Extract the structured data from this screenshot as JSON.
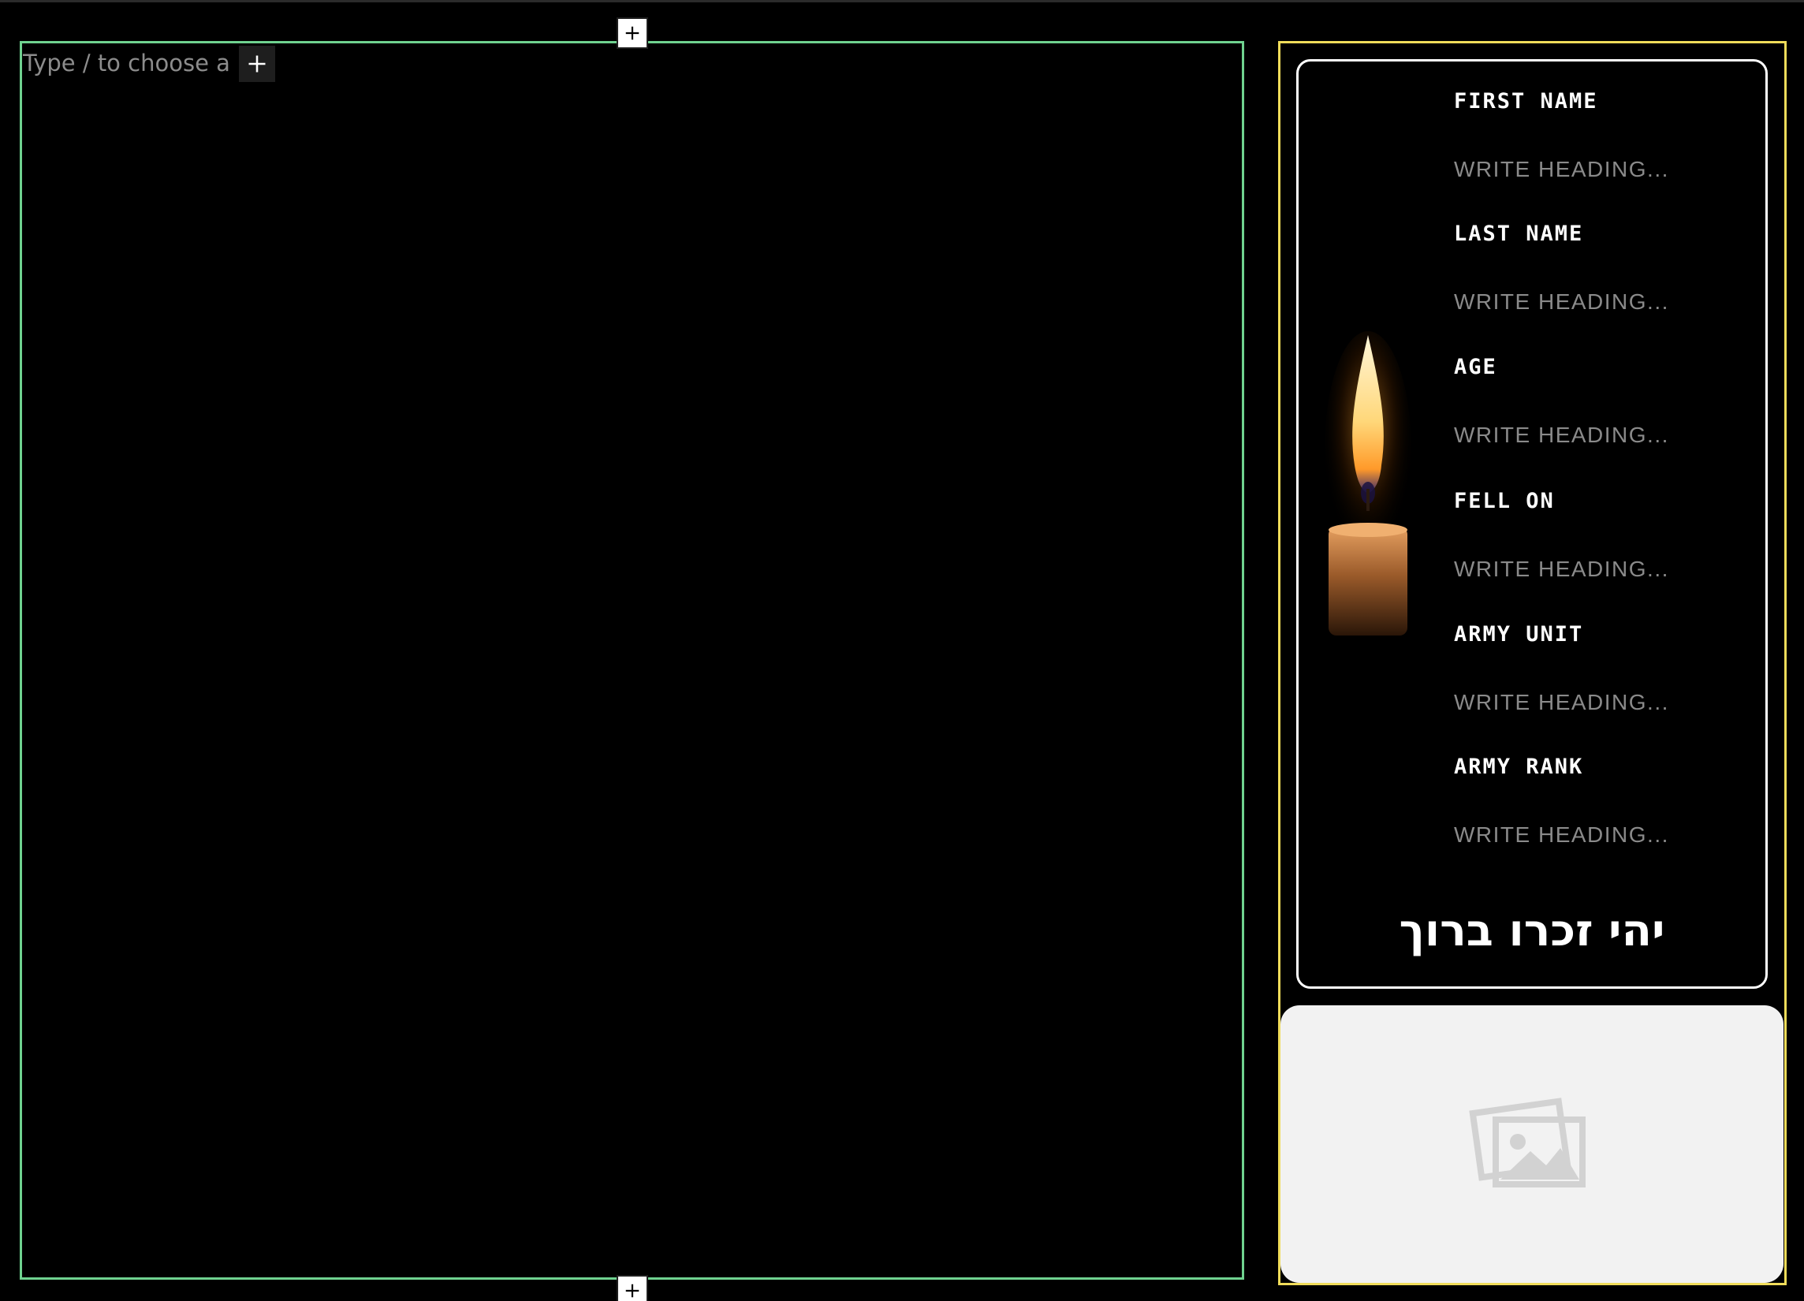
{
  "editor": {
    "placeholder": "Type / to choose a bl",
    "inserter_top_label": "Add block",
    "inserter_bottom_label": "Add block",
    "block_inserter_label": "Add block"
  },
  "memorial": {
    "fields": [
      {
        "label": "FIRST NAME",
        "value": "WRITE HEADING..."
      },
      {
        "label": "LAST NAME",
        "value": "WRITE HEADING..."
      },
      {
        "label": "AGE",
        "value": "WRITE HEADING..."
      },
      {
        "label": "FELL ON",
        "value": "WRITE HEADING..."
      },
      {
        "label": "ARMY UNIT",
        "value": "WRITE HEADING..."
      },
      {
        "label": "ARMY RANK",
        "value": "WRITE HEADING..."
      }
    ],
    "blessing": "יהי זכרו ברוך",
    "candle_icon": "candle-icon",
    "image_icon": "image-placeholder-icon"
  },
  "colors": {
    "background": "#000000",
    "group_outline": "#6fd28f",
    "column_outline": "#f0dc5a",
    "card_border": "#ffffff",
    "label_text": "#ffffff",
    "value_text": "#8a8a8a",
    "image_placeholder_bg": "#f2f2f2"
  }
}
